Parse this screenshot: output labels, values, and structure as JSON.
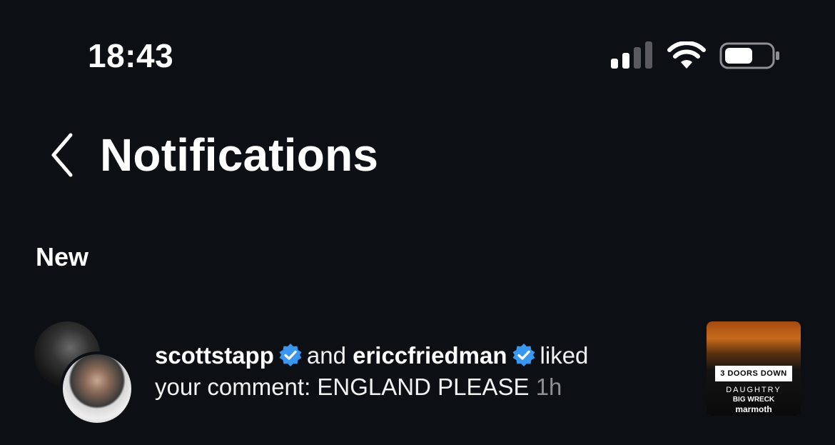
{
  "status_bar": {
    "time": "18:43",
    "signal_icon": "cellular-signal-icon",
    "wifi_icon": "wifi-icon",
    "battery_icon": "battery-icon"
  },
  "header": {
    "back_icon": "chevron-left-icon",
    "title": "Notifications"
  },
  "sections": [
    {
      "label": "New",
      "notifications": [
        {
          "user1": "scottstapp",
          "user2": "ericcfriedman",
          "connector": "and",
          "action": "liked",
          "message": "your comment: ENGLAND PLEASE",
          "time": "1h",
          "thumbnail": {
            "band": "3 DOORS DOWN",
            "line1": "DAUGHTRY",
            "line2": "BIG WRECK",
            "line3": "marmoth"
          }
        }
      ]
    }
  ],
  "colors": {
    "background": "#0c0f14",
    "verified_blue": "#3897f0",
    "secondary_text": "#8e8e93"
  }
}
